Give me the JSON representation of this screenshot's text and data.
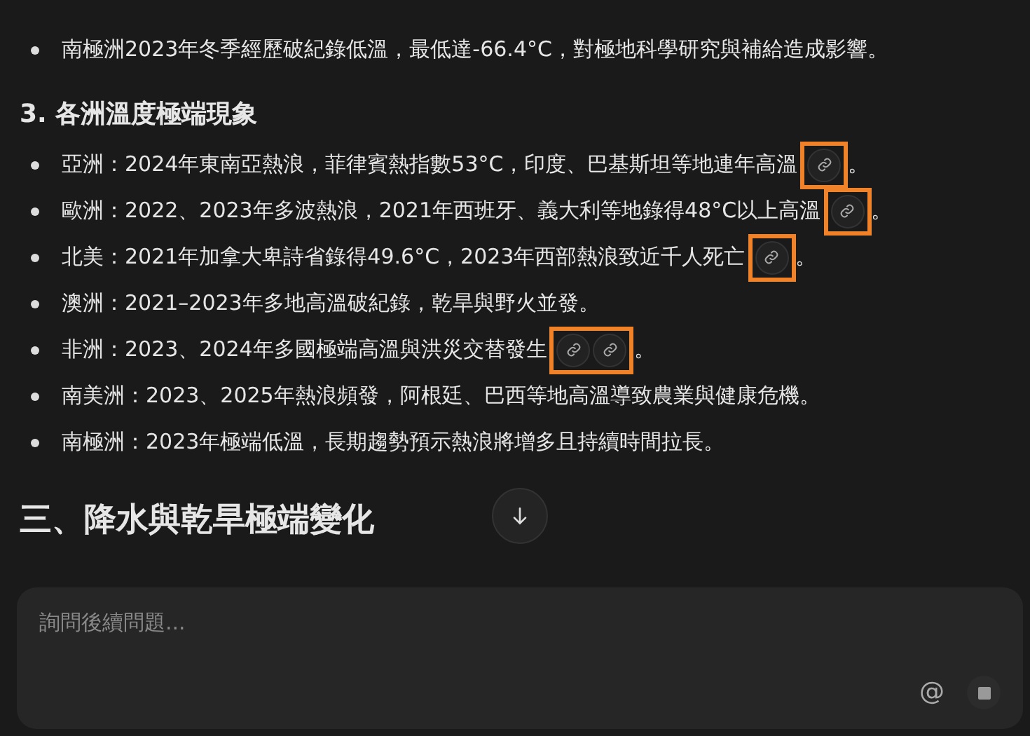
{
  "top_list": [
    {
      "text": "南極洲2023年冬季經歷破紀錄低溫，最低達-66.4°C，對極地科學研究與補給造成影響。"
    }
  ],
  "subheading": "3. 各洲溫度極端現象",
  "items": [
    {
      "text": "亞洲：2024年東南亞熱浪，菲律賓熱指數53°C，印度、巴基斯坦等地連年高溫",
      "citations": [
        {
          "kind": "link"
        }
      ],
      "highlighted": true,
      "end": "。"
    },
    {
      "text": "歐洲：2022、2023年多波熱浪，2021年西班牙、義大利等地錄得48°C以上高溫",
      "citations": [
        {
          "kind": "link"
        }
      ],
      "highlighted": true,
      "end": "。"
    },
    {
      "text": "北美：2021年加拿大卑詩省錄得49.6°C，2023年西部熱浪致近千人死亡",
      "citations": [
        {
          "kind": "link"
        }
      ],
      "highlighted": true,
      "end": "。"
    },
    {
      "text": "澳洲：2021–2023年多地高溫破紀錄，乾旱與野火並發。"
    },
    {
      "text": "非洲：2023、2024年多國極端高溫與洪災交替發生",
      "citations": [
        {
          "kind": "link"
        },
        {
          "kind": "link"
        }
      ],
      "highlighted": true,
      "end": "。"
    },
    {
      "text": "南美洲：2023、2025年熱浪頻發，阿根廷、巴西等地高溫導致農業與健康危機。"
    },
    {
      "text": "南極洲：2023年極端低溫，長期趨勢預示熱浪將增多且持續時間拉長。"
    }
  ],
  "section_heading": "三、降水與乾旱極端變化",
  "composer": {
    "placeholder": "詢問後續問題...",
    "mention_symbol": "@"
  }
}
